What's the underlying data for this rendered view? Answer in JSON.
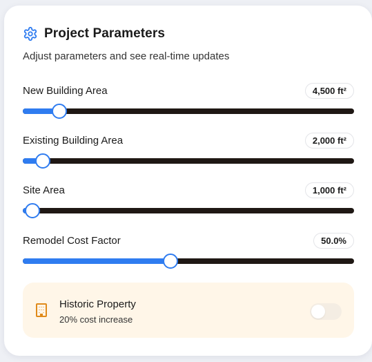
{
  "header": {
    "title": "Project Parameters",
    "subtitle": "Adjust parameters and see real-time updates",
    "icon": "gear-icon"
  },
  "params": [
    {
      "label": "New Building Area",
      "value": "4,500 ft²",
      "fraction": 0.11
    },
    {
      "label": "Existing Building Area",
      "value": "2,000 ft²",
      "fraction": 0.06
    },
    {
      "label": "Site Area",
      "value": "1,000 ft²",
      "fraction": 0.03
    },
    {
      "label": "Remodel Cost Factor",
      "value": "50.0%",
      "fraction": 0.445
    }
  ],
  "historic": {
    "title": "Historic Property",
    "subtitle": "20% cost increase",
    "icon": "building-icon",
    "enabled": false
  },
  "colors": {
    "accent": "#2f7cf0",
    "track": "#1f1814",
    "historic_bg": "#fff6e8",
    "historic_icon": "#e08a1a"
  }
}
